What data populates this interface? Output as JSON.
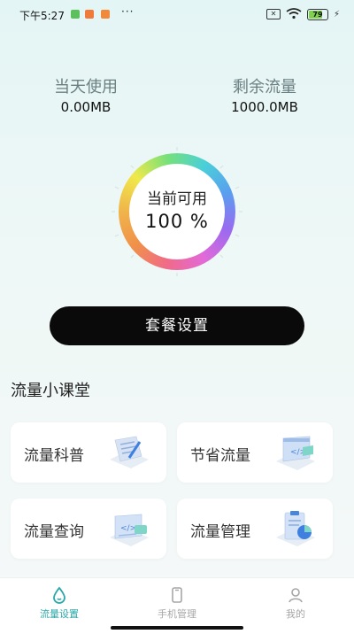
{
  "status_bar": {
    "time": "下午5:27",
    "sim_glyph": "✕",
    "battery": "79",
    "dots": "···"
  },
  "stats": {
    "today_label": "当天使用",
    "today_value": "0.00MB",
    "remaining_label": "剩余流量",
    "remaining_value": "1000.0MB"
  },
  "gauge": {
    "title": "当前可用",
    "value": "100 %"
  },
  "plan_button": "套餐设置",
  "section_title": "流量小课堂",
  "cards": [
    {
      "label": "流量科普",
      "icon": "document-pen-icon"
    },
    {
      "label": "节省流量",
      "icon": "code-window-icon"
    },
    {
      "label": "流量查询",
      "icon": "code-search-icon"
    },
    {
      "label": "流量管理",
      "icon": "clipboard-chart-icon"
    }
  ],
  "nav": {
    "items": [
      {
        "label": "流量设置",
        "active": true,
        "icon": "droplet-icon"
      },
      {
        "label": "手机管理",
        "active": false,
        "icon": "phone-icon"
      },
      {
        "label": "我的",
        "active": false,
        "icon": "user-icon"
      }
    ]
  },
  "colors": {
    "accent": "#2aa7a7",
    "inactive": "#a6a6a6",
    "button": "#0a0a0a"
  }
}
